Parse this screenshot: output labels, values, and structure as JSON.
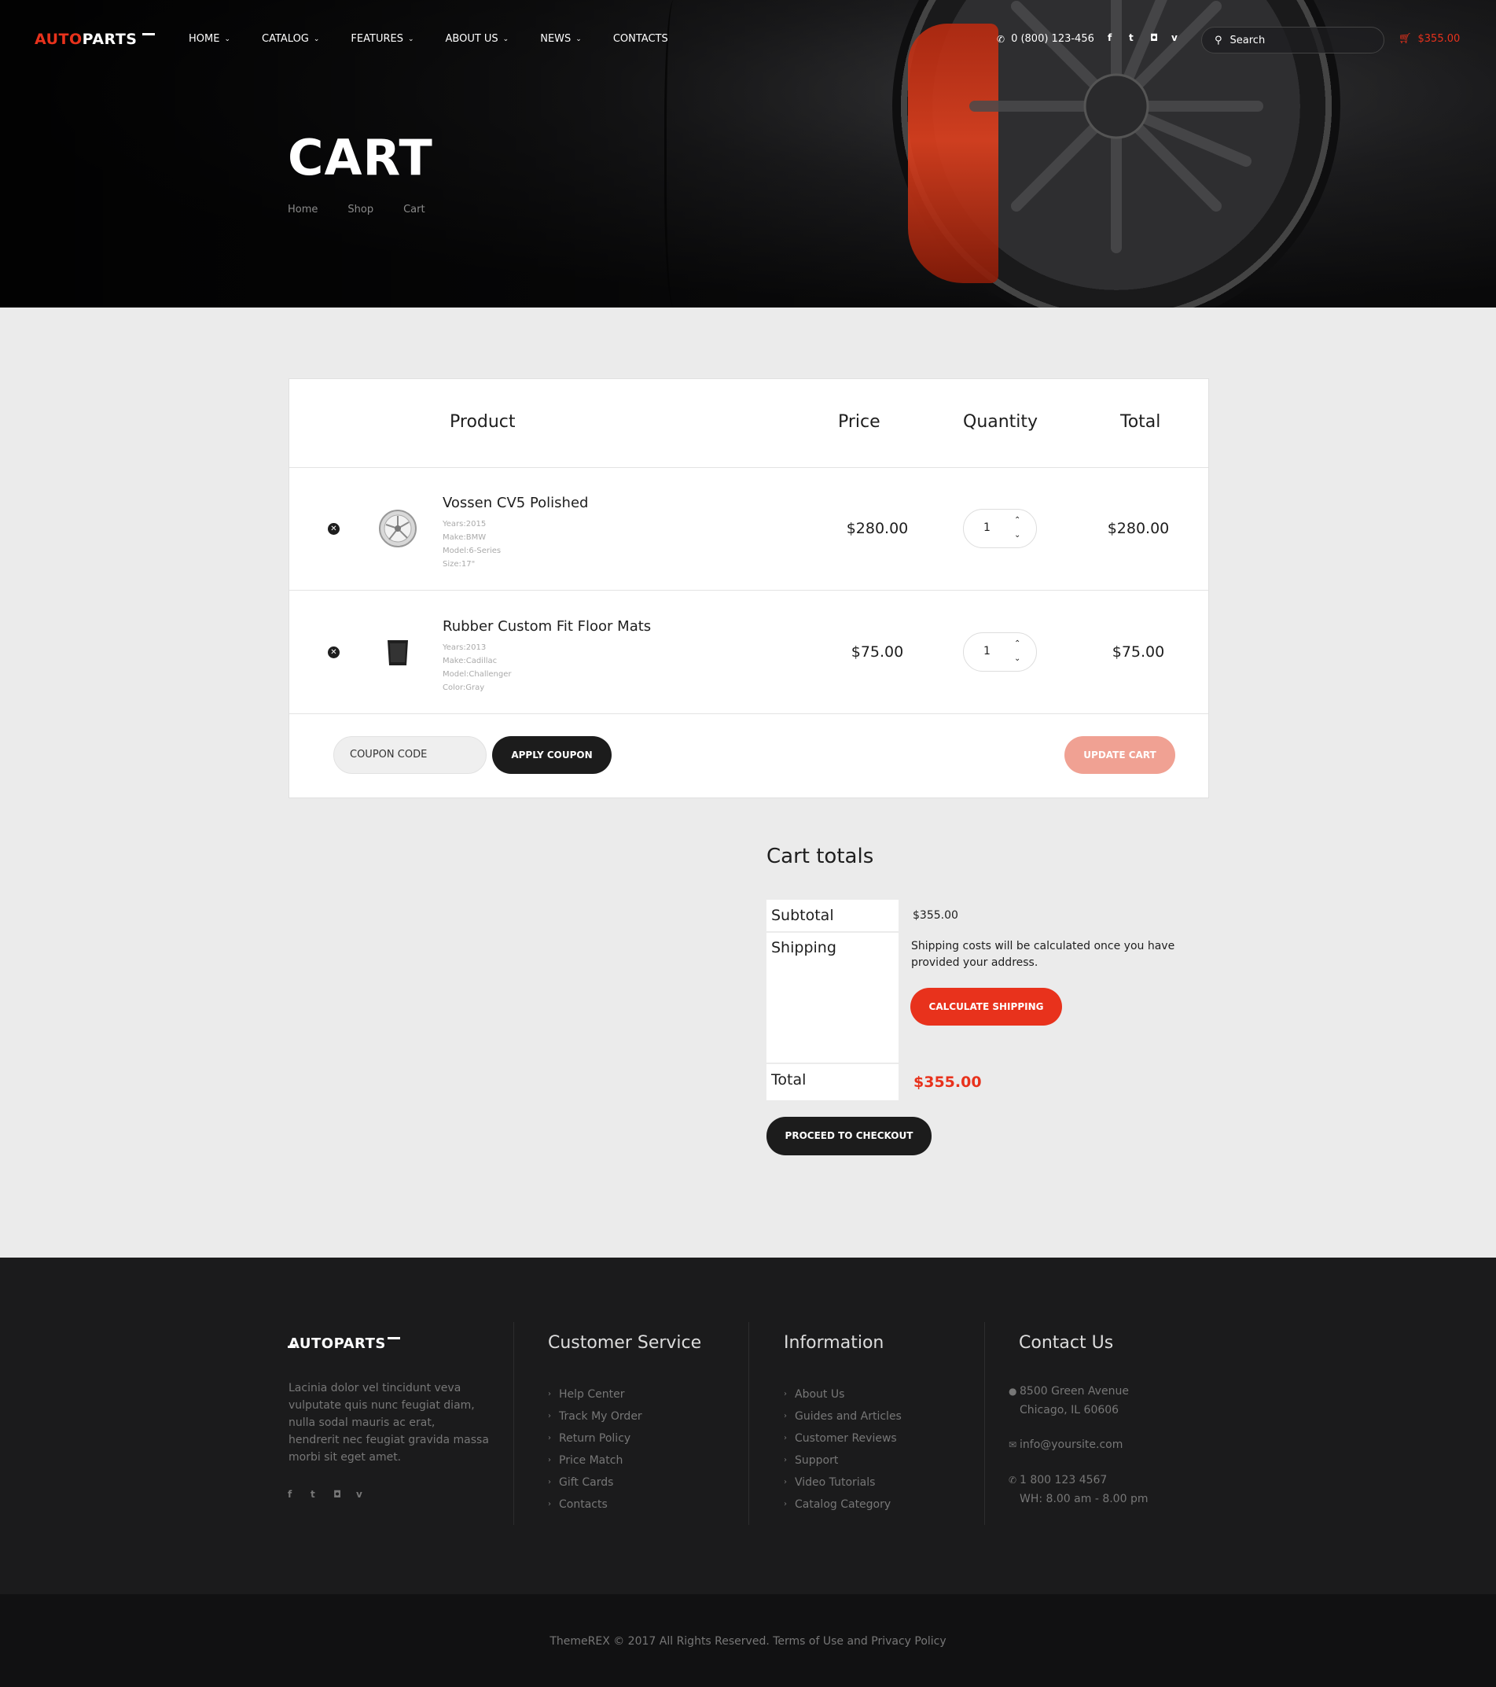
{
  "header": {
    "logo_left": "AUTO",
    "logo_right": "PARTS",
    "menu": [
      {
        "label": "HOME"
      },
      {
        "label": "CATALOG"
      },
      {
        "label": "FEATURES"
      },
      {
        "label": "ABOUT US"
      },
      {
        "label": "NEWS"
      },
      {
        "label": "CONTACTS"
      }
    ],
    "phone": "0 (800) 123-456",
    "search_placeholder": "Search",
    "cart_total": "$355.00"
  },
  "hero": {
    "title": "CART",
    "breadcrumbs": [
      "Home",
      "Shop",
      "Cart"
    ]
  },
  "cart": {
    "columns": {
      "product": "Product",
      "price": "Price",
      "quantity": "Quantity",
      "total": "Total"
    },
    "items": [
      {
        "name": "Vossen CV5 Polished",
        "meta": [
          "Years:2015",
          "Make:BMW",
          "Model:6-Series",
          "Size:17\""
        ],
        "price": "$280.00",
        "quantity": "1",
        "total": "$280.00"
      },
      {
        "name": "Rubber Custom Fit Floor Mats",
        "meta": [
          "Years:2013",
          "Make:Cadillac",
          "Model:Challenger",
          "Color:Gray"
        ],
        "price": "$75.00",
        "quantity": "1",
        "total": "$75.00"
      }
    ],
    "coupon_placeholder": "COUPON CODE",
    "apply_label": "APPLY COUPON",
    "update_label": "UPDATE CART"
  },
  "totals": {
    "title": "Cart totals",
    "subtotal_label": "Subtotal",
    "subtotal_value": "$355.00",
    "shipping_label": "Shipping",
    "shipping_note": "Shipping costs will be calculated once you have provided your address.",
    "calc_label": "CALCULATE SHIPPING",
    "total_label": "Total",
    "total_value": "$355.00",
    "checkout_label": "PROCEED TO CHECKOUT"
  },
  "footer": {
    "logo": "AUTOPARTS",
    "about": "Lacinia dolor vel tincidunt veva vulputate quis nunc feugiat diam, nulla sodal mauris ac erat, hendrerit nec feugiat gravida massa morbi sit eget amet.",
    "customer_service": {
      "title": "Customer Service",
      "links": [
        "Help Center",
        "Track My Order",
        "Return Policy",
        "Price Match",
        "Gift Cards",
        "Contacts"
      ]
    },
    "information": {
      "title": "Information",
      "links": [
        "About Us",
        "Guides and Articles",
        "Customer Reviews",
        "Support",
        "Video Tutorials",
        "Catalog Category"
      ]
    },
    "contact": {
      "title": "Contact Us",
      "address_1": "8500 Green Avenue",
      "address_2": "Chicago, IL 60606",
      "email": "info@yoursite.com",
      "phone": "1 800 123 4567",
      "hours": "WH: 8.00 am - 8.00 pm"
    },
    "copyright": "ThemeREX © 2017 All Rights Reserved. Terms of Use and Privacy Policy"
  },
  "colors": {
    "accent": "#e8321c",
    "dark": "#1c1c1c",
    "update_button": "#f0a193"
  }
}
